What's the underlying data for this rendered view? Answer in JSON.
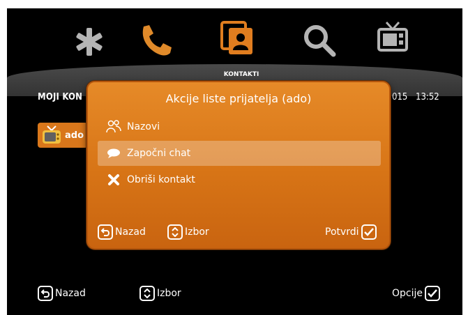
{
  "nav": {
    "items": [
      {
        "icon": "star-icon"
      },
      {
        "icon": "phone-icon"
      },
      {
        "icon": "contacts-icon",
        "active": true
      },
      {
        "icon": "search-icon"
      },
      {
        "icon": "tv-icon"
      }
    ],
    "active_label": "KONTAKTI"
  },
  "header": {
    "title": "MOJI KON",
    "date": "015",
    "time": "13:52"
  },
  "contact": {
    "name": "ado",
    "icon": "tv-icon"
  },
  "dialog": {
    "title": "Akcije liste prijatelja (ado)",
    "items": [
      {
        "label": "Nazovi",
        "icon": "people-icon",
        "selected": false
      },
      {
        "label": "Započni chat",
        "icon": "chat-bubble-icon",
        "selected": true
      },
      {
        "label": "Obriši kontakt",
        "icon": "close-icon",
        "selected": false
      }
    ],
    "back_label": "Nazad",
    "select_label": "Izbor",
    "confirm_label": "Potvrdi"
  },
  "footer": {
    "back_label": "Nazad",
    "select_label": "Izbor",
    "options_label": "Opcije"
  },
  "colors": {
    "accent": "#e07d1f",
    "background": "#000000",
    "text": "#ffffff"
  }
}
